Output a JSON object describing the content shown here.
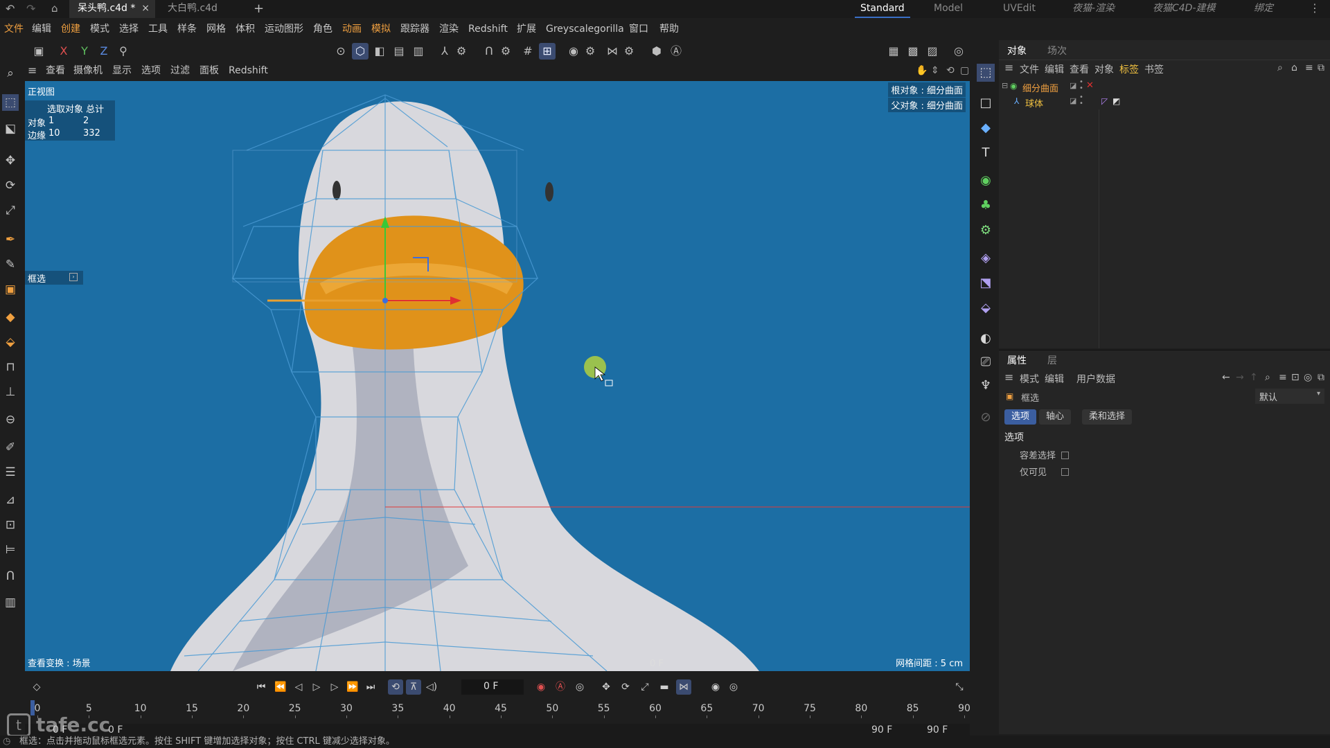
{
  "tabs": {
    "file1": "呆头鸭.c4d *",
    "file2": "大白鸭.c4d",
    "add": "+"
  },
  "layouts": [
    "Standard",
    "Model",
    "UVEdit",
    "夜猫-渲染",
    "夜猫C4D-建模",
    "绑定"
  ],
  "menu": [
    "文件",
    "编辑",
    "创建",
    "模式",
    "选择",
    "工具",
    "样条",
    "网格",
    "体积",
    "运动图形",
    "角色",
    "动画",
    "模拟",
    "跟踪器",
    "渲染",
    "Redshift",
    "扩展",
    "Greyscalegorilla",
    "窗口",
    "帮助"
  ],
  "toolbar": {
    "x": "X",
    "y": "Y",
    "z": "Z"
  },
  "viewport_menu": [
    "查看",
    "摄像机",
    "显示",
    "选项",
    "过滤",
    "面板",
    "Redshift"
  ],
  "viewport": {
    "name": "正视图",
    "stats_header": "选取对象 总计",
    "stats_rows": [
      {
        "label": "对象",
        "sel": "1",
        "total": "2"
      },
      {
        "label": "边缘",
        "sel": "10",
        "total": "332"
      }
    ],
    "tool_label": "框选",
    "root_object": "根对象 : 细分曲面",
    "parent_object": "父对象 : 细分曲面",
    "transform_label": "查看变换 : 场景",
    "frame_label": "0 F",
    "grid_label": "网格间距 : 5 cm"
  },
  "object_panel": {
    "tabs": [
      "对象",
      "场次"
    ],
    "menu": [
      "文件",
      "编辑",
      "查看",
      "对象",
      "标签",
      "书签"
    ],
    "objects": [
      {
        "name": "细分曲面",
        "color": "#f0a040"
      },
      {
        "name": "球体",
        "color": "#f0c040"
      }
    ]
  },
  "attr_panel": {
    "tabs": [
      "属性",
      "层"
    ],
    "menu": [
      "模式",
      "编辑",
      "用户数据"
    ],
    "tool": "框选",
    "preset": "默认",
    "subtabs": [
      "选项",
      "轴心",
      "柔和选择"
    ],
    "section": "选项",
    "options": [
      "容差选择",
      "仅可见"
    ]
  },
  "timeline": {
    "current_frame": "0 F",
    "ticks": [
      "0",
      "5",
      "10",
      "15",
      "20",
      "25",
      "30",
      "35",
      "40",
      "45",
      "50",
      "55",
      "60",
      "65",
      "70",
      "75",
      "80",
      "85",
      "90"
    ],
    "start_a": "0 F",
    "start_b": "0 F",
    "end_a": "90 F",
    "end_b": "90 F"
  },
  "watermark": "tafe.cc",
  "status": "框选：点击并拖动鼠标框选元素。按住 SHIFT 键增加选择对象；按住 CTRL 键减少选择对象。",
  "colors": {
    "viewport_bg": "#1c6ea4",
    "accent": "#3b5ea0",
    "beak": "#e89a1c",
    "duck": "#d9d9de"
  }
}
